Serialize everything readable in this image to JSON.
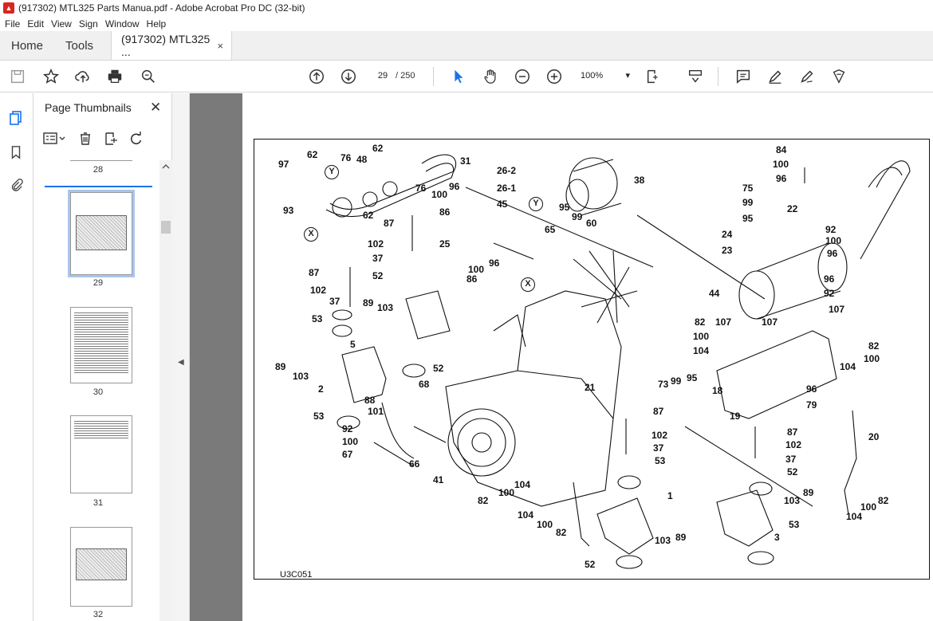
{
  "window": {
    "title": "(917302) MTL325 Parts Manua.pdf - Adobe Acrobat Pro DC (32-bit)"
  },
  "menu": [
    "File",
    "Edit",
    "View",
    "Sign",
    "Window",
    "Help"
  ],
  "tabs": {
    "home": "Home",
    "tools": "Tools",
    "document": "(917302) MTL325 ...",
    "close": "×"
  },
  "toolbar": {
    "current_page": "29",
    "total_pages": "/ 250",
    "zoom": "100%",
    "zoom_caret": "▾"
  },
  "panel": {
    "title": "Page Thumbnails",
    "close": "✕",
    "thumbnails": [
      {
        "label": "28"
      },
      {
        "label": "29"
      },
      {
        "label": "30"
      },
      {
        "label": "31"
      },
      {
        "label": "32"
      }
    ]
  },
  "figure": {
    "code": "U3C051",
    "callouts": [
      "X",
      "Y",
      "Y",
      "X"
    ],
    "parts": [
      "62",
      "97",
      "Y",
      "76",
      "48",
      "62",
      "31",
      "26-2",
      "96",
      "26-1",
      "38",
      "93",
      "62",
      "76",
      "100",
      "45",
      "Y",
      "95",
      "99",
      "60",
      "84",
      "100",
      "96",
      "75",
      "99",
      "22",
      "95",
      "92",
      "100",
      "96",
      "24",
      "23",
      "96",
      "92",
      "107",
      "44",
      "87",
      "86",
      "25",
      "65",
      "102",
      "37",
      "96",
      "86",
      "100",
      "52",
      "X",
      "87",
      "102",
      "89",
      "37",
      "103",
      "53",
      "5",
      "82",
      "107",
      "107",
      "100",
      "104",
      "82",
      "100",
      "104",
      "52",
      "89",
      "103",
      "2",
      "68",
      "88",
      "101",
      "73",
      "99",
      "95",
      "18",
      "96",
      "79",
      "19",
      "87",
      "53",
      "92",
      "100",
      "67",
      "66",
      "41",
      "21",
      "102",
      "37",
      "53",
      "87",
      "102",
      "37",
      "52",
      "20",
      "104",
      "100",
      "82",
      "82",
      "100",
      "104",
      "1",
      "103",
      "89",
      "104",
      "100",
      "82",
      "103",
      "89",
      "3",
      "53",
      "52"
    ]
  }
}
